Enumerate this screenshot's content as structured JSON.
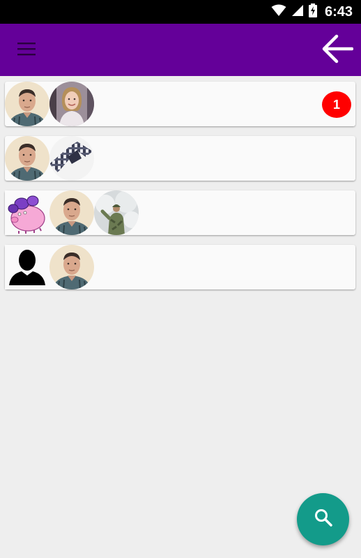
{
  "status_bar": {
    "time": "6:43",
    "icons": [
      "wifi-icon",
      "signal-icon",
      "battery-charging-icon"
    ]
  },
  "toolbar": {
    "menu_icon": "hamburger-menu-icon",
    "back_icon": "arrow-left-icon",
    "background": "#640099"
  },
  "conversations": [
    {
      "avatars": [
        "man-photo",
        "woman-photo"
      ],
      "unread_badge": "1"
    },
    {
      "avatars": [
        "man-photo",
        "tie-photo"
      ],
      "unread_badge": ""
    },
    {
      "avatars": [
        "pink-pig-sticker",
        "man-photo",
        "soldier-photo"
      ],
      "unread_badge": ""
    },
    {
      "avatars": [
        "default-user-silhouette",
        "man-photo"
      ],
      "unread_badge": ""
    }
  ],
  "fab": {
    "icon": "search-icon",
    "color": "#139b8a"
  },
  "colors": {
    "badge": "#ff0000",
    "background": "#eeeeee"
  }
}
